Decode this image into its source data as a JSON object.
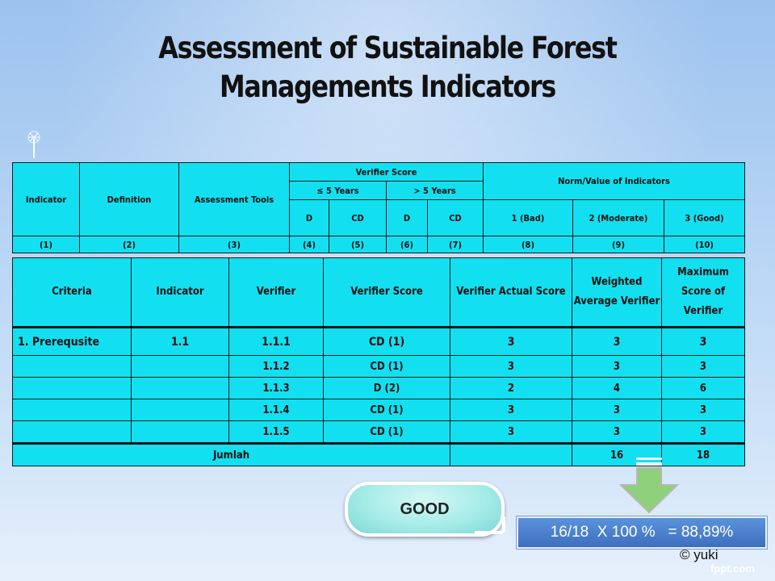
{
  "title": "Assessment of Sustainable Forest Managements Indicators",
  "table1": {
    "indicator": "Indicator",
    "definition": "Definition",
    "assessment_tools": "Assessment Tools",
    "verifier_score": "Verifier Score",
    "norm_value": "Norm/Value of Indicators",
    "le5": "≤ 5 Years",
    "gt5": "> 5 Years",
    "d1": "D",
    "cd1": "CD",
    "d2": "D",
    "cd2": "CD",
    "bad": "1 (Bad)",
    "moderate": "2 (Moderate)",
    "good": "3 (Good)",
    "numbers": [
      "(1)",
      "(2)",
      "(3)",
      "(4)",
      "(5)",
      "(6)",
      "(7)",
      "(8)",
      "(9)",
      "(10)"
    ]
  },
  "table2": {
    "headers": [
      "Criteria",
      "Indicator",
      "Verifier",
      "Verifier Score",
      "Verifier  Actual Score",
      "Weighted Average Verifier",
      "Maximum Score of Verifier"
    ],
    "rows": [
      {
        "criteria": "1.  Prerequsite",
        "indicator": "1.1",
        "verifier": "1.1.1",
        "score": "CD (1)",
        "actual": "3",
        "weighted": "3",
        "max": "3"
      },
      {
        "criteria": "",
        "indicator": "",
        "verifier": "1.1.2",
        "score": "CD (1)",
        "actual": "3",
        "weighted": "3",
        "max": "3"
      },
      {
        "criteria": "",
        "indicator": "",
        "verifier": "1.1.3",
        "score": "D (2)",
        "actual": "2",
        "weighted": "4",
        "max": "6"
      },
      {
        "criteria": "",
        "indicator": "",
        "verifier": "1.1.4",
        "score": "CD (1)",
        "actual": "3",
        "weighted": "3",
        "max": "3"
      },
      {
        "criteria": "",
        "indicator": "",
        "verifier": "1.1.5",
        "score": "CD (1)",
        "actual": "3",
        "weighted": "3",
        "max": "3"
      }
    ],
    "total_label": "Jumlah",
    "total_weighted": "16",
    "total_max": "18"
  },
  "bubble_text": "GOOD",
  "result_text": "16/18  X 100 %   = 88,89%",
  "credit": "© yuki",
  "watermark": "fppt.com",
  "colors": {
    "table_fill": "#12e0f0",
    "result_fill": "#4a7fcc",
    "bubble_fill": "#a6ece8",
    "arrow_fill": "#8fd07a"
  }
}
